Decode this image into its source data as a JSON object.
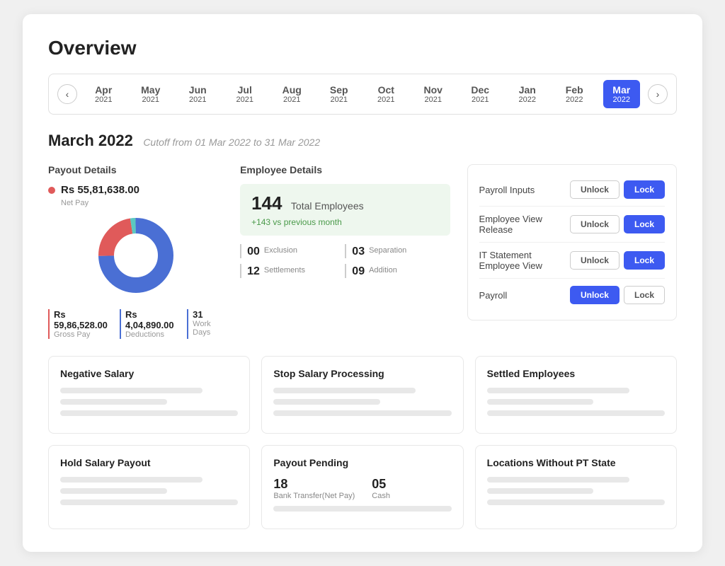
{
  "page": {
    "title": "Overview"
  },
  "timeline": {
    "prev_btn": "‹",
    "next_btn": "›",
    "months": [
      {
        "label": "Apr",
        "year": "2021",
        "active": false
      },
      {
        "label": "May",
        "year": "2021",
        "active": false
      },
      {
        "label": "Jun",
        "year": "2021",
        "active": false
      },
      {
        "label": "Jul",
        "year": "2021",
        "active": false
      },
      {
        "label": "Aug",
        "year": "2021",
        "active": false
      },
      {
        "label": "Sep",
        "year": "2021",
        "active": false
      },
      {
        "label": "Oct",
        "year": "2021",
        "active": false
      },
      {
        "label": "Nov",
        "year": "2021",
        "active": false
      },
      {
        "label": "Dec",
        "year": "2021",
        "active": false
      },
      {
        "label": "Jan",
        "year": "2022",
        "active": false
      },
      {
        "label": "Feb",
        "year": "2022",
        "active": false
      },
      {
        "label": "Mar",
        "year": "2022",
        "active": true
      }
    ]
  },
  "period": {
    "month_year": "March 2022",
    "cutoff": "Cutoff from 01 Mar 2022 to 31 Mar 2022"
  },
  "payout": {
    "section_title": "Payout Details",
    "net_pay_amount": "Rs 55,81,638.00",
    "net_pay_label": "Net Pay",
    "gross_pay_amount": "Rs 59,86,528.00",
    "gross_pay_label": "Gross Pay",
    "deductions_amount": "Rs 4,04,890.00",
    "deductions_label": "Deductions",
    "work_days_num": "31",
    "work_days_label": "Work Days"
  },
  "employees": {
    "section_title": "Employee Details",
    "total": "144",
    "total_label": "Total Employees",
    "change": "+143 vs previous month",
    "exclusion_num": "00",
    "exclusion_label": "Exclusion",
    "separation_num": "03",
    "separation_label": "Separation",
    "settlements_num": "12",
    "settlements_label": "Settlements",
    "addition_num": "09",
    "addition_label": "Addition"
  },
  "locks": [
    {
      "label": "Payroll Inputs",
      "unlock_active": false,
      "lock_active": true
    },
    {
      "label": "Employee View Release",
      "unlock_active": false,
      "lock_active": true
    },
    {
      "label": "IT Statement Employee View",
      "unlock_active": false,
      "lock_active": true
    },
    {
      "label": "Payroll",
      "unlock_active": true,
      "lock_active": false
    }
  ],
  "bottom_cards": [
    {
      "title": "Negative Salary",
      "type": "skeleton"
    },
    {
      "title": "Stop Salary Processing",
      "type": "skeleton"
    },
    {
      "title": "Settled Employees",
      "type": "skeleton"
    },
    {
      "title": "Hold Salary Payout",
      "type": "skeleton"
    },
    {
      "title": "Payout Pending",
      "type": "payout_pending",
      "bank_num": "18",
      "bank_label": "Bank Transfer(Net Pay)",
      "cash_num": "05",
      "cash_label": "Cash"
    },
    {
      "title": "Locations Without PT State",
      "type": "skeleton"
    }
  ],
  "btn_labels": {
    "unlock": "Unlock",
    "lock": "Lock"
  },
  "colors": {
    "accent_blue": "#3d5af1",
    "donut_red": "#e05a5a",
    "donut_blue": "#4a6fd4",
    "donut_teal": "#5bc8c0"
  }
}
